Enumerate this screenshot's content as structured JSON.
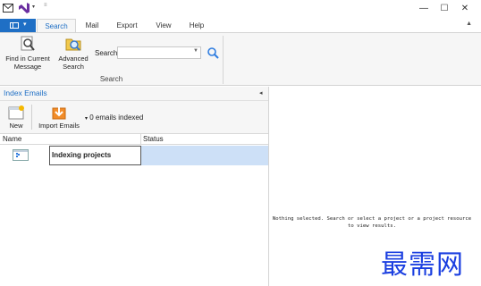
{
  "titlebar": {
    "controls": {
      "minimize": "—",
      "maximize": "☐",
      "close": "✕"
    }
  },
  "ribbon": {
    "tabs": [
      {
        "label": "Search",
        "active": true
      },
      {
        "label": "Mail",
        "active": false
      },
      {
        "label": "Export",
        "active": false
      },
      {
        "label": "Help",
        "active": false
      }
    ],
    "find_current_message": "Find in Current Message",
    "advanced_search": "Advanced Search",
    "search_label": "Search",
    "search_value": "",
    "group_label": "Search"
  },
  "index_pane": {
    "title": "Index Emails",
    "new_label": "New",
    "import_label": "Import Emails",
    "emails_indexed": "0 emails indexed",
    "columns": {
      "name": "Name",
      "status": "Status"
    },
    "rows": [
      {
        "name": "Indexing projects",
        "status": ""
      }
    ]
  },
  "detail_pane": {
    "empty_message": "Nothing selected. Search or select a project or a project resource to view results."
  },
  "watermark": "最需网",
  "colors": {
    "accent": "#1f6fc5",
    "selection": "#cde0f7",
    "ribbon_bg": "#f6f6f6",
    "watermark": "#1b3fe0"
  },
  "icons": [
    "mail-app-icon",
    "visual-studio-icon",
    "qat-dropdown-icon",
    "find-message-icon",
    "advanced-search-icon",
    "search-go-icon",
    "new-icon",
    "import-emails-icon",
    "project-icon"
  ]
}
